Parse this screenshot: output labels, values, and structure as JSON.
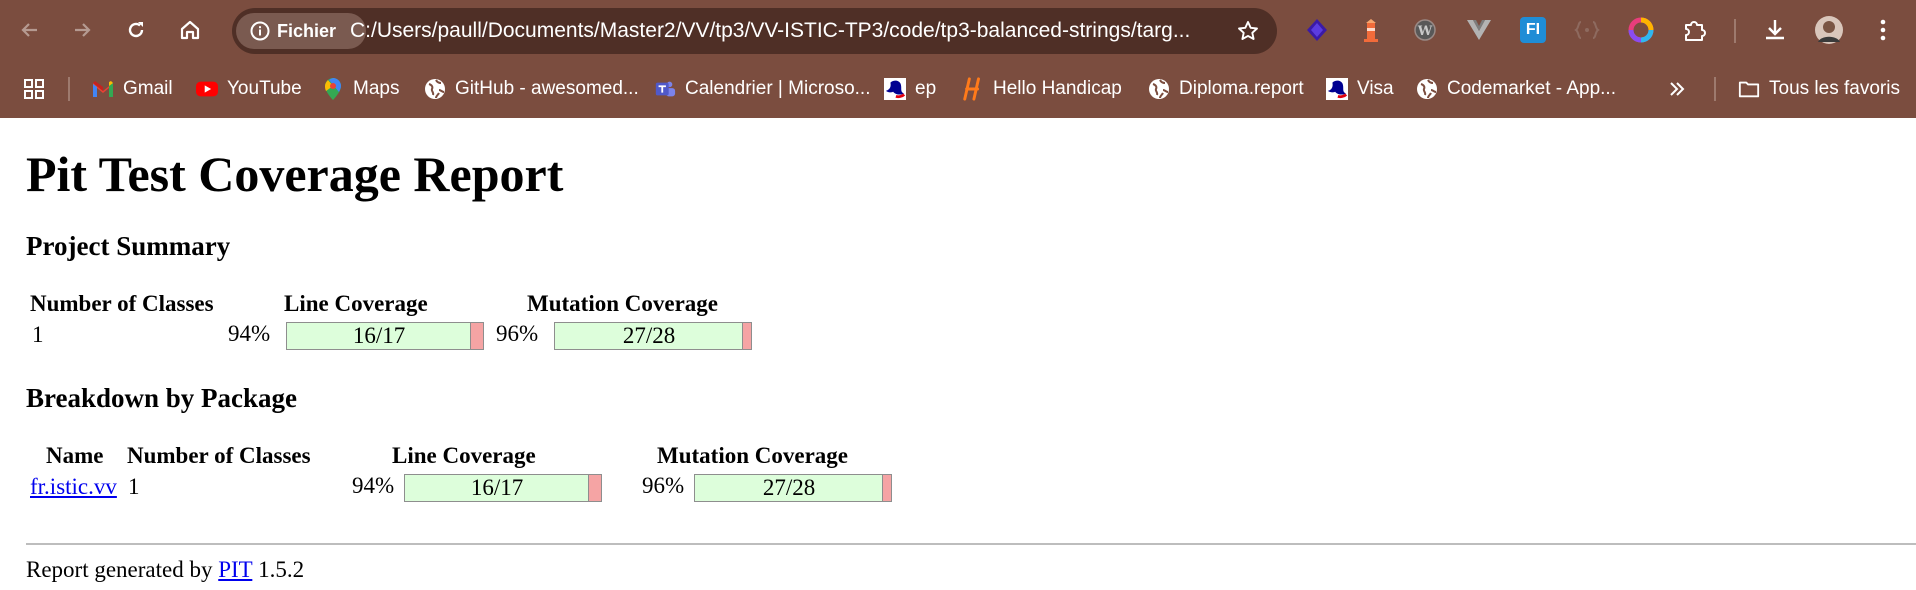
{
  "browser": {
    "chip_label": "Fichier",
    "url": "C:/Users/paull/Documents/Master2/VV/tp3/VV-ISTIC-TP3/code/tp3-balanced-strings/targ...",
    "extension_label": "FI",
    "bookmarks": [
      {
        "label": "Gmail",
        "icon": "gmail-icon"
      },
      {
        "label": "YouTube",
        "icon": "youtube-icon"
      },
      {
        "label": "Maps",
        "icon": "maps-icon"
      },
      {
        "label": "GitHub - awesomed...",
        "icon": "globe-icon"
      },
      {
        "label": "Calendrier | Microso...",
        "icon": "teams-icon"
      },
      {
        "label": "ep",
        "icon": "marianne-icon"
      },
      {
        "label": "Hello Handicap",
        "icon": "handicap-h-icon"
      },
      {
        "label": "Diploma.report",
        "icon": "globe-icon"
      },
      {
        "label": "Visa",
        "icon": "marianne-icon"
      },
      {
        "label": "Codemarket - App...",
        "icon": "globe-icon"
      }
    ],
    "all_bookmarks_label": "Tous les favoris"
  },
  "report": {
    "title": "Pit Test Coverage Report",
    "project_summary": {
      "heading": "Project Summary",
      "headers": {
        "classes": "Number of Classes",
        "line": "Line Coverage",
        "mutation": "Mutation Coverage"
      },
      "classes": "1",
      "line_percent": "94%",
      "line_fraction": "16/17",
      "line_ratio": 0.94,
      "mutation_percent": "96%",
      "mutation_fraction": "27/28",
      "mutation_ratio": 0.96
    },
    "breakdown": {
      "heading": "Breakdown by Package",
      "headers": {
        "name": "Name",
        "classes": "Number of Classes",
        "line": "Line Coverage",
        "mutation": "Mutation Coverage"
      },
      "rows": [
        {
          "name": "fr.istic.vv",
          "classes": "1",
          "line_percent": "94%",
          "line_fraction": "16/17",
          "line_ratio": 0.94,
          "mutation_percent": "96%",
          "mutation_fraction": "27/28",
          "mutation_ratio": 0.96
        }
      ]
    },
    "footer": {
      "prefix": "Report generated by",
      "link": "PIT",
      "version": "1.5.2"
    }
  }
}
